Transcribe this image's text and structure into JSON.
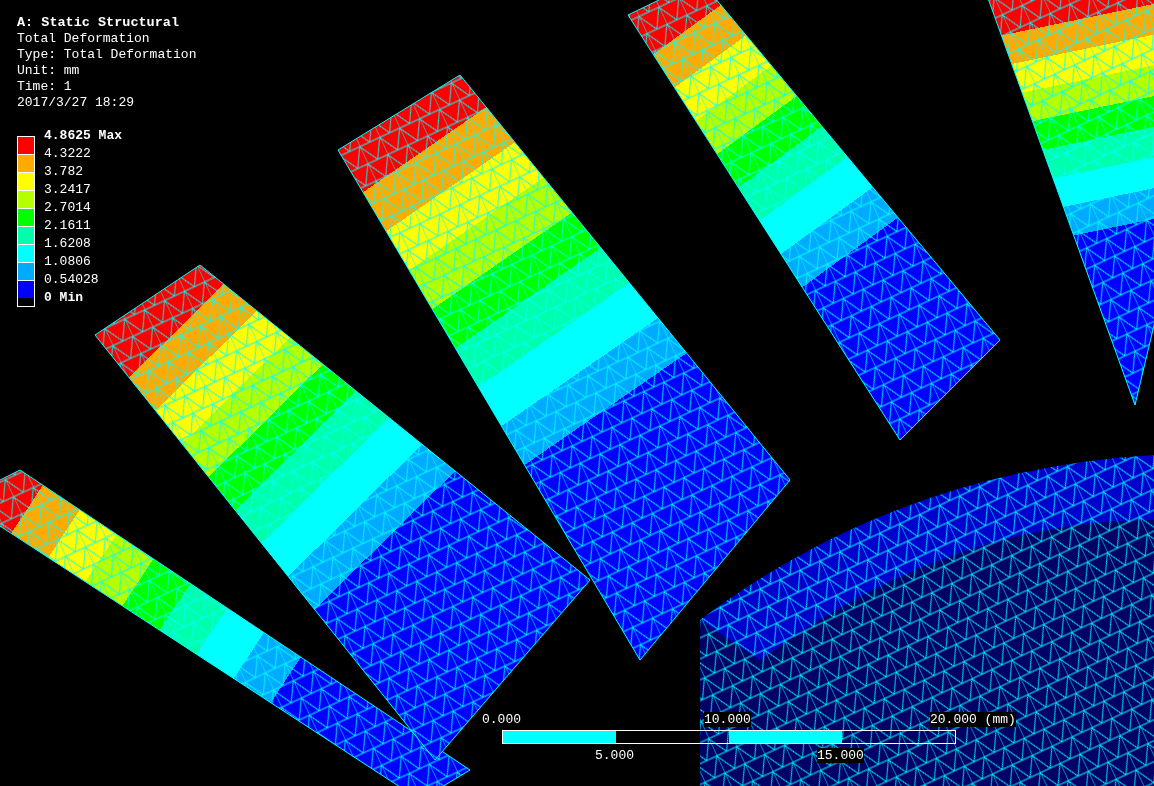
{
  "header": {
    "title": "A: Static Structural",
    "lines": [
      "Total Deformation",
      "Type: Total Deformation",
      "Unit: mm",
      "Time: 1",
      "2017/3/27 18:29"
    ]
  },
  "legend": {
    "labels": [
      {
        "text": "4.8625 Max",
        "kind": "max"
      },
      {
        "text": "4.3222",
        "kind": "value"
      },
      {
        "text": "3.782",
        "kind": "value"
      },
      {
        "text": "3.2417",
        "kind": "value"
      },
      {
        "text": "2.7014",
        "kind": "value"
      },
      {
        "text": "2.1611",
        "kind": "value"
      },
      {
        "text": "1.6208",
        "kind": "value"
      },
      {
        "text": "1.0806",
        "kind": "value"
      },
      {
        "text": "0.54028",
        "kind": "value"
      },
      {
        "text": "0 Min",
        "kind": "min"
      }
    ],
    "bands": [
      {
        "color": "#ff0000"
      },
      {
        "color": "#ffaa00"
      },
      {
        "color": "#ffff00"
      },
      {
        "color": "#b4ff00"
      },
      {
        "color": "#00ff00"
      },
      {
        "color": "#00ffaa"
      },
      {
        "color": "#00ffff"
      },
      {
        "color": "#00aaff"
      },
      {
        "color": "#0000ff"
      }
    ]
  },
  "scale_bar": {
    "top_labels": [
      "0.000",
      "10.000",
      "20.000 (mm)"
    ],
    "bottom_labels": [
      "5.000",
      "15.000"
    ]
  }
}
